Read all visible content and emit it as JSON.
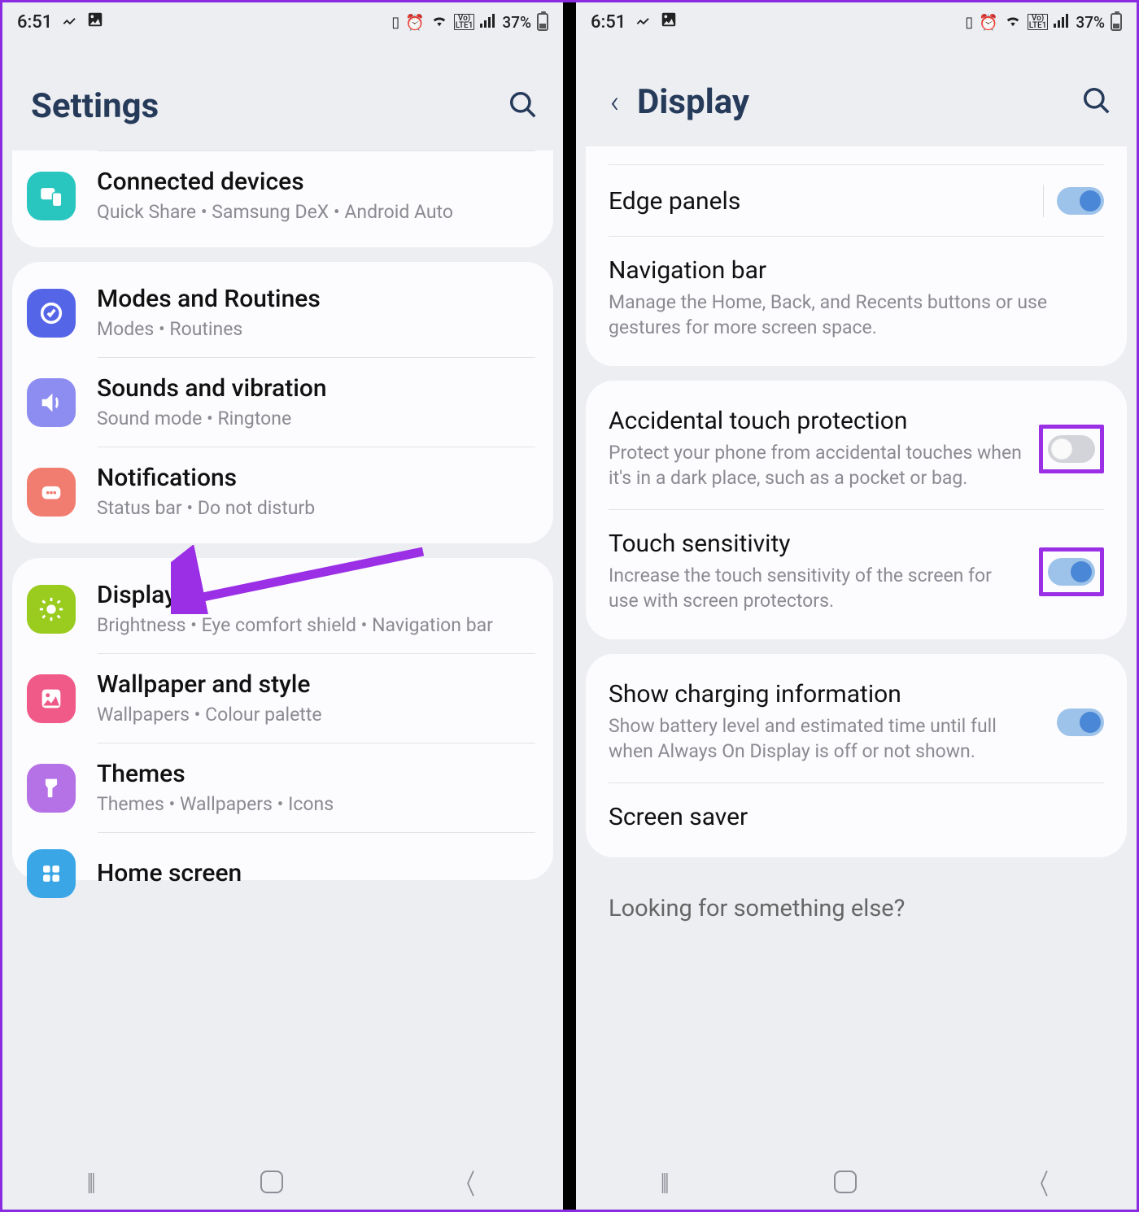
{
  "status": {
    "time": "6:51",
    "battery_pct": "37%"
  },
  "left": {
    "header": "Settings",
    "rows": [
      {
        "icon": "devices",
        "title": "Connected devices",
        "sub": "Quick Share  •  Samsung DeX  •  Android Auto"
      },
      {
        "icon": "modes",
        "title": "Modes and Routines",
        "sub": "Modes  •  Routines"
      },
      {
        "icon": "sound",
        "title": "Sounds and vibration",
        "sub": "Sound mode  •  Ringtone"
      },
      {
        "icon": "notif",
        "title": "Notifications",
        "sub": "Status bar  •  Do not disturb"
      },
      {
        "icon": "display",
        "title": "Display",
        "sub": "Brightness  •  Eye comfort shield  •  Navigation bar"
      },
      {
        "icon": "wallpaper",
        "title": "Wallpaper and style",
        "sub": "Wallpapers  •  Colour palette"
      },
      {
        "icon": "themes",
        "title": "Themes",
        "sub": "Themes  •  Wallpapers  •  Icons"
      },
      {
        "icon": "home",
        "title": "Home screen",
        "sub": ""
      }
    ]
  },
  "right": {
    "header": "Display",
    "group1": [
      {
        "title": "Edge panels",
        "sub": "",
        "toggle": "on",
        "sep": true
      },
      {
        "title": "Navigation bar",
        "sub": "Manage the Home, Back, and Recents buttons or use gestures for more screen space."
      }
    ],
    "group2": [
      {
        "title": "Accidental touch protection",
        "sub": "Protect your phone from accidental touches when it's in a dark place, such as a pocket or bag.",
        "toggle": "off",
        "hl": true
      },
      {
        "title": "Touch sensitivity",
        "sub": "Increase the touch sensitivity of the screen for use with screen protectors.",
        "toggle": "on",
        "hl": true
      }
    ],
    "group3": [
      {
        "title": "Show charging information",
        "sub": "Show battery level and estimated time until full when Always On Display is off or not shown.",
        "toggle": "on"
      },
      {
        "title": "Screen saver",
        "sub": ""
      }
    ],
    "looking": "Looking for something else?"
  }
}
